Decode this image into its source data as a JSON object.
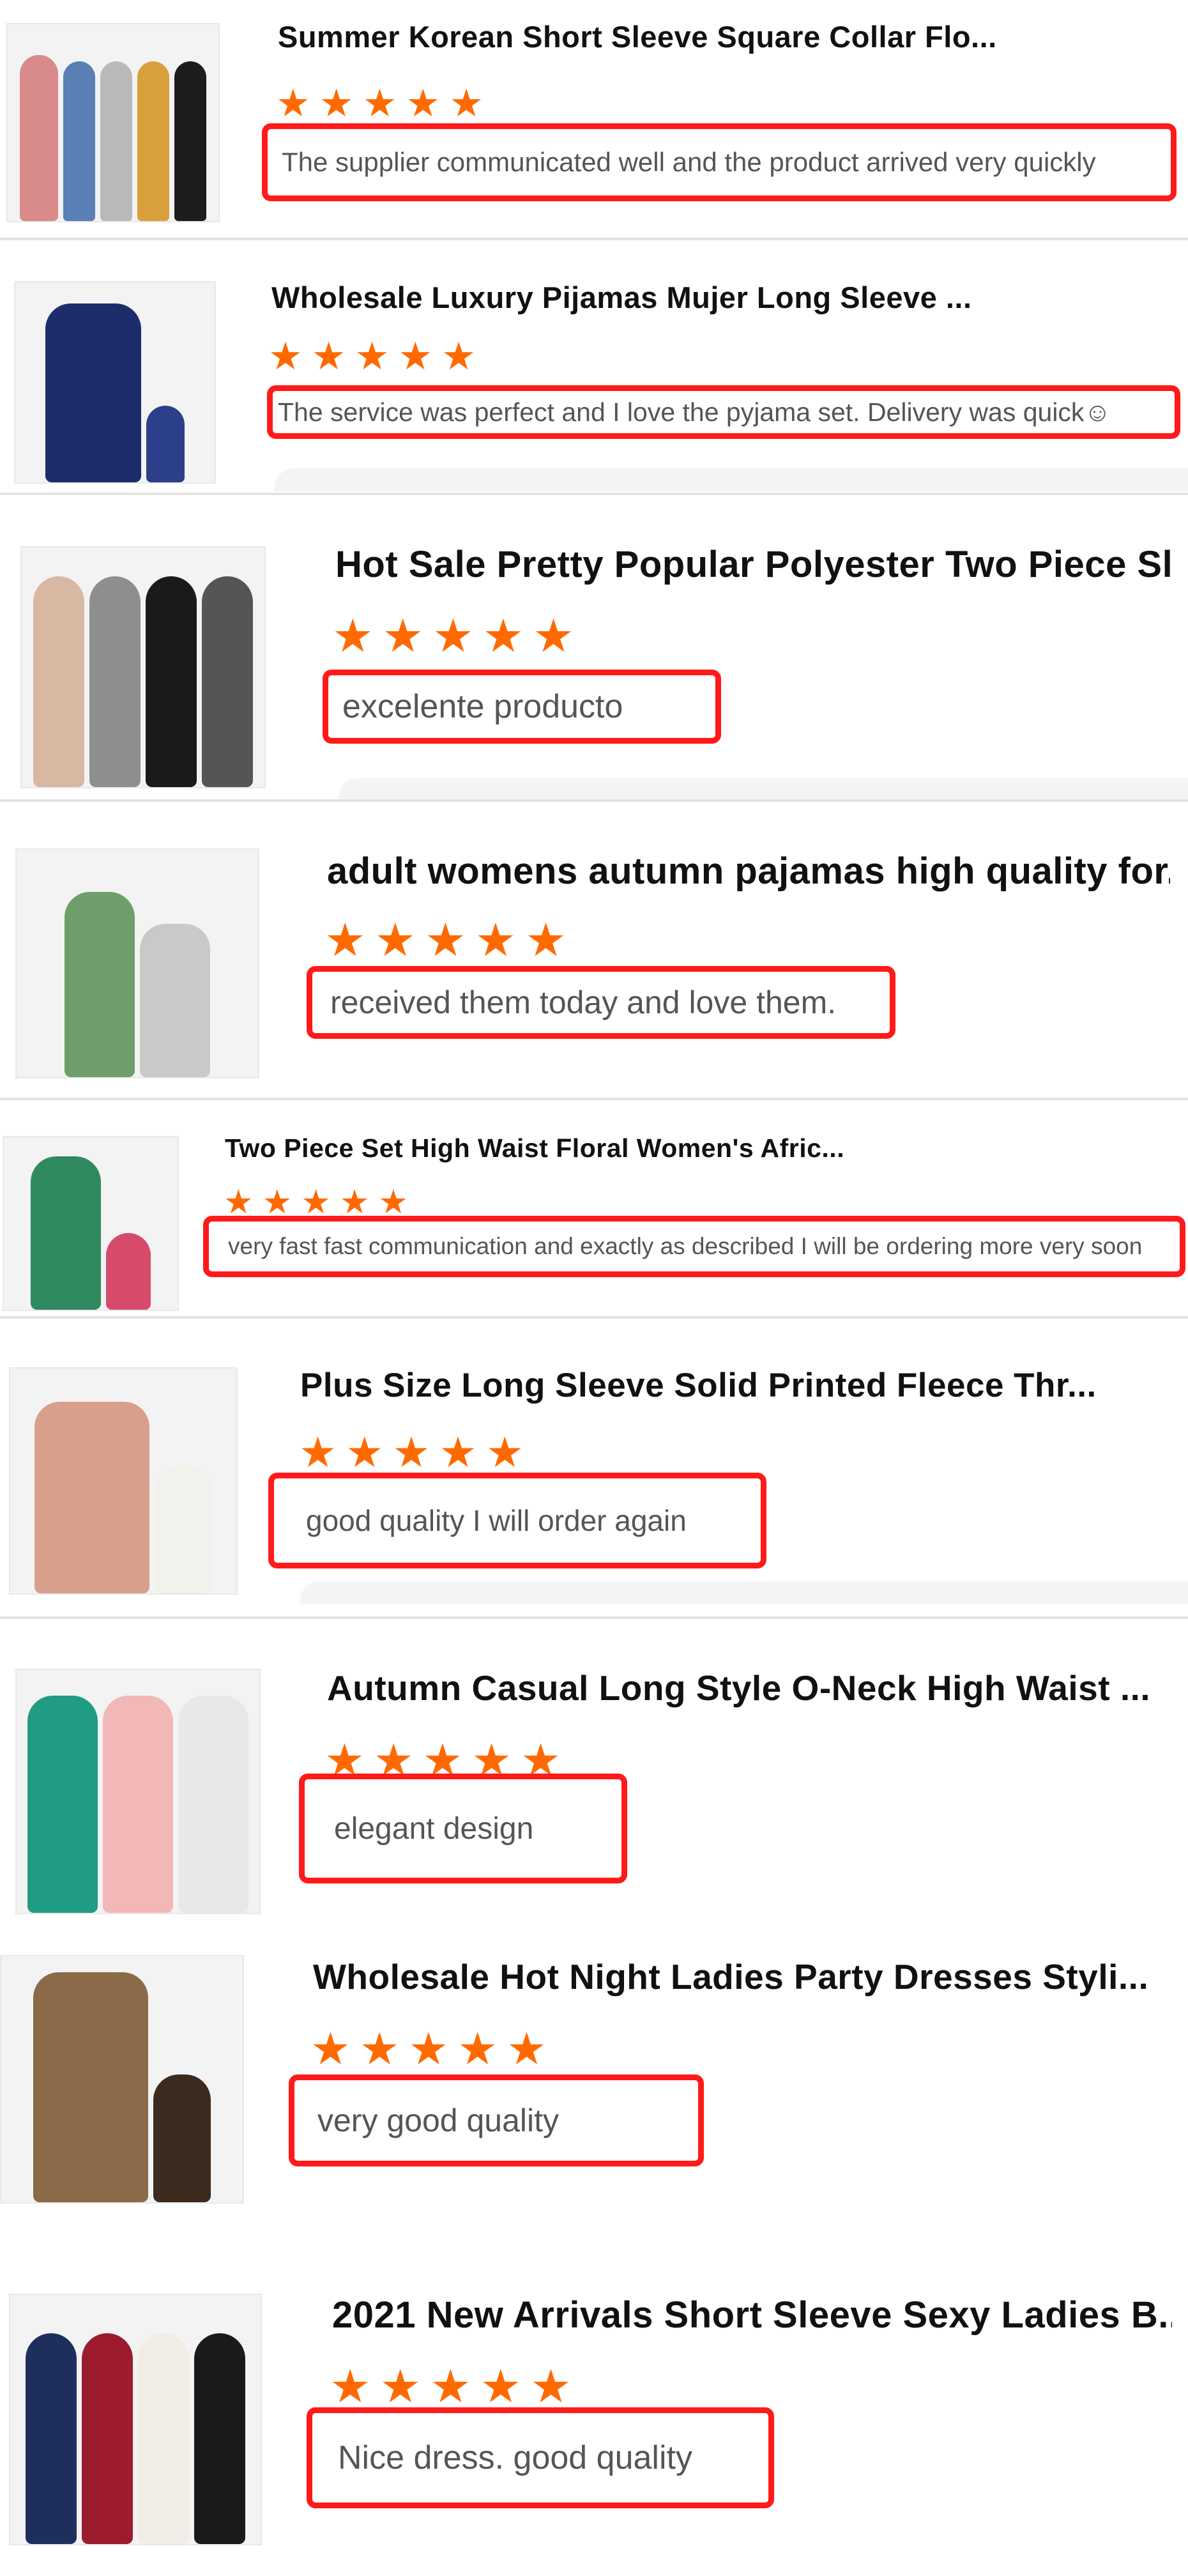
{
  "rating_star": "★",
  "items": [
    {
      "title": "Summer Korean Short Sleeve Square Collar Flo...",
      "stars": 5,
      "review": "The supplier communicated well and the product arrived very quickly",
      "thumb_colors": [
        "#d98a8a",
        "#5a7fb5",
        "#b9b9b9",
        "#d9a13b",
        "#1d1d1d"
      ]
    },
    {
      "title": "Wholesale Luxury Pijamas Mujer Long Sleeve ...",
      "stars": 5,
      "review": "The service was perfect and I love the pyjama set. Delivery was quick☺",
      "thumb_colors": [
        "#1d2d6b",
        "#2c3f8a"
      ]
    },
    {
      "title": "Hot Sale Pretty Popular Polyester Two Piece Sl...",
      "stars": 5,
      "review": "excelente producto",
      "thumb_colors": [
        "#d8b8a2",
        "#8e8e8e",
        "#1a1a1a",
        "#555555"
      ]
    },
    {
      "title": "adult womens autumn pajamas high quality for...",
      "stars": 5,
      "review": "received them today and love them.",
      "thumb_colors": [
        "#6e9f6b",
        "#c9c9c9"
      ]
    },
    {
      "title": "Two Piece Set High Waist Floral Women's Afric...",
      "stars": 5,
      "review": "very fast fast communication and exactly as described I will be ordering more very soon",
      "thumb_colors": [
        "#2f8a5f",
        "#d64a6a"
      ]
    },
    {
      "title": "Plus Size Long Sleeve Solid Printed Fleece Thr...",
      "stars": 5,
      "review": "good quality I will order again",
      "thumb_colors": [
        "#d8a08c",
        "#f3f1ec"
      ]
    },
    {
      "title": "Autumn Casual Long Style O-Neck High Waist ...",
      "stars": 5,
      "review": "elegant design",
      "thumb_colors": [
        "#1f9c82",
        "#f2b7b7",
        "#e8e8e8"
      ]
    },
    {
      "title": "Wholesale Hot Night Ladies Party Dresses Styli...",
      "stars": 5,
      "review": "very good quality",
      "thumb_colors": [
        "#8a6a48",
        "#3b2a1e"
      ]
    },
    {
      "title": "2021 New Arrivals Short Sleeve Sexy Ladies B...",
      "stars": 5,
      "review": "Nice dress. good quality",
      "thumb_colors": [
        "#1e2f5e",
        "#9c1c2d",
        "#f1ede6",
        "#1a1a1a"
      ]
    }
  ],
  "colors": {
    "accent_star": "#ff6a00",
    "review_border": "#ff1a1a",
    "divider": "#e3e3e3"
  }
}
